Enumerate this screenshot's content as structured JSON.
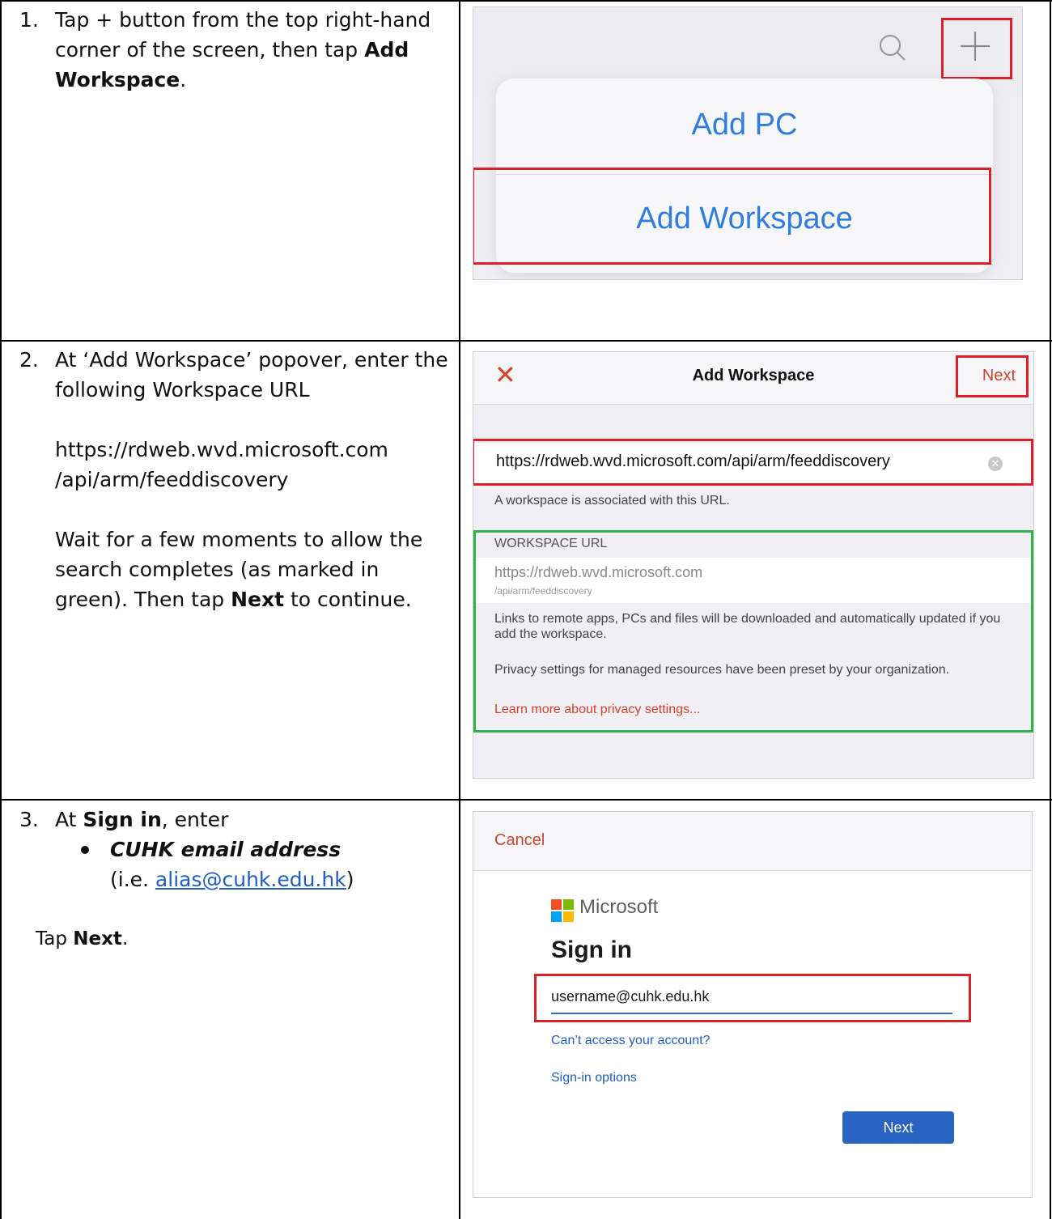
{
  "steps": [
    {
      "number": "1.",
      "text_a": "Tap + button from the top right-hand corner of the screen, then tap ",
      "text_bold": "Add Workspace",
      "text_b": "."
    },
    {
      "number": "2.",
      "line1": "At ‘Add Workspace’ popover, enter the following Workspace URL",
      "url_line1": "https://rdweb.wvd.microsoft.com",
      "url_line2": "/api/arm/feeddiscovery",
      "wait_a": "Wait for a few moments to allow the search completes (as marked in green).  Then tap ",
      "wait_bold": "Next",
      "wait_b": " to continue."
    },
    {
      "number": "3.",
      "at": "At ",
      "at_bold": "Sign in",
      "at_b": ", enter",
      "bullet": "CUHK email address",
      "ie_a": "(i.e. ",
      "ie_link": "alias@cuhk.edu.hk",
      "ie_b": ")",
      "tap": "Tap ",
      "tap_bold": "Next",
      "tap_b": "."
    }
  ],
  "shot1": {
    "add_pc": "Add PC",
    "add_workspace": "Add Workspace",
    "icons": [
      "search-icon",
      "plus-icon"
    ]
  },
  "shot2": {
    "title": "Add Workspace",
    "next": "Next",
    "url_value": "https://rdweb.wvd.microsoft.com/api/arm/feeddiscovery",
    "note": "A workspace is associated with this URL.",
    "section_label": "WORKSPACE URL",
    "ws_url_main": "https://rdweb.wvd.microsoft.com",
    "ws_url_sub": "/api/arm/feeddiscovery",
    "info1": "Links to remote apps, PCs and files will be downloaded and automatically updated if you add the workspace.",
    "info2": "Privacy settings for managed resources have been preset by your organization.",
    "learn_more": "Learn more about privacy settings...",
    "icons": [
      "close-icon",
      "clear-icon"
    ]
  },
  "shot3": {
    "cancel": "Cancel",
    "brand": "Microsoft",
    "heading": "Sign in",
    "email_value": "username@cuhk.edu.hk",
    "link_access": "Can’t access your account?",
    "link_options": "Sign-in options",
    "next_button": "Next",
    "logo_colors": [
      "#f25022",
      "#7fba00",
      "#00a4ef",
      "#ffb900"
    ]
  },
  "colors": {
    "highlight_red": "#dd1f2a",
    "highlight_green": "#2fb24a",
    "ios_blue": "#2f7de1"
  }
}
